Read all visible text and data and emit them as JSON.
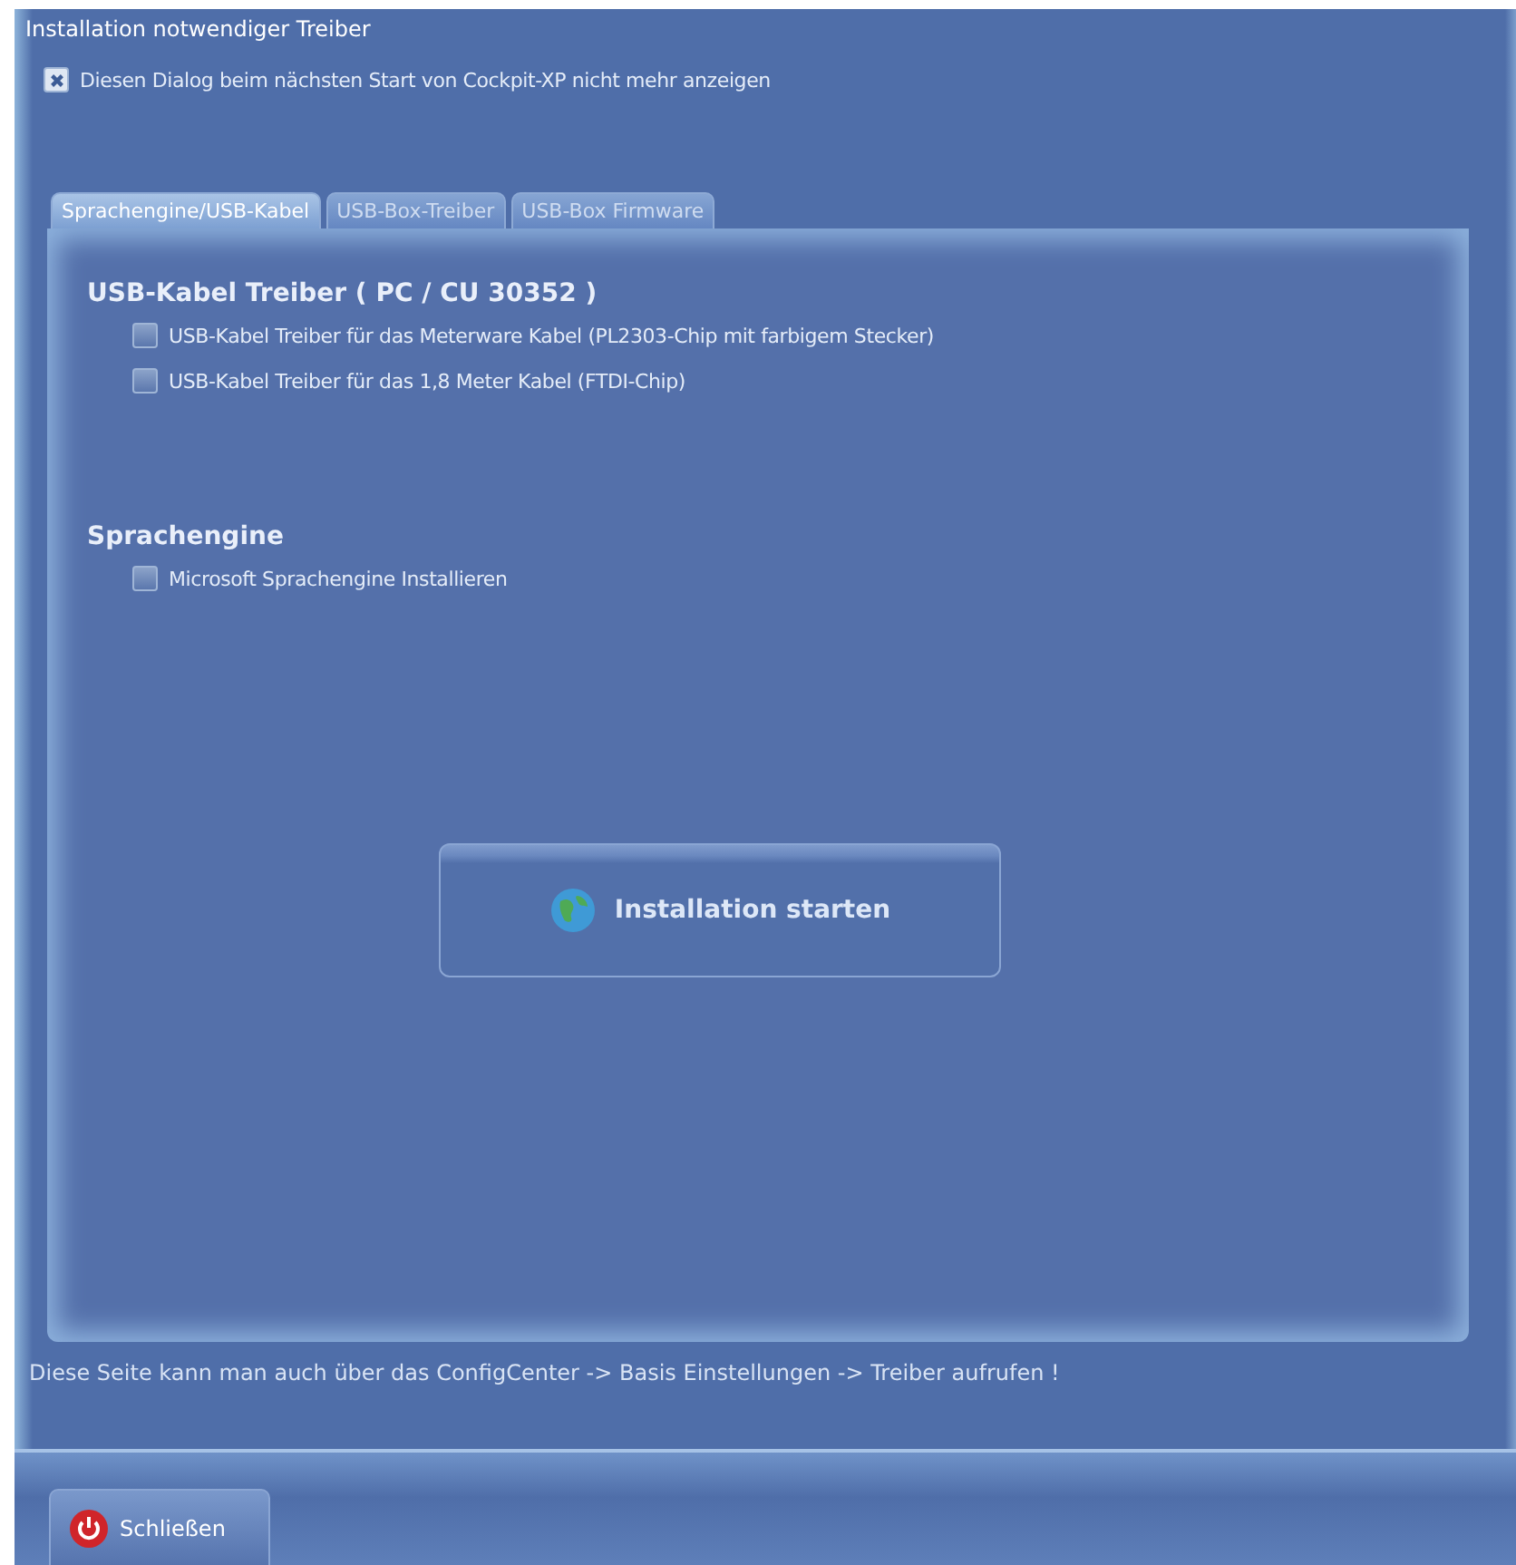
{
  "window": {
    "title": "Installation notwendiger Treiber"
  },
  "dont_show_again": {
    "label": "Diesen Dialog beim nächsten Start von Cockpit-XP nicht mehr anzeigen",
    "checked": true
  },
  "tabs": [
    {
      "label": "Sprachengine/USB-Kabel",
      "selected": true
    },
    {
      "label": "USB-Box-Treiber",
      "selected": false
    },
    {
      "label": "USB-Box Firmware",
      "selected": false
    }
  ],
  "sections": [
    {
      "heading": "USB-Kabel Treiber ( PC / CU 30352 )",
      "options": [
        {
          "label": "USB-Kabel Treiber für das Meterware Kabel (PL2303-Chip mit farbigem Stecker)",
          "checked": false
        },
        {
          "label": "USB-Kabel Treiber für das 1,8 Meter Kabel (FTDI-Chip)",
          "checked": false
        }
      ]
    },
    {
      "heading": "Sprachengine",
      "options": [
        {
          "label": "Microsoft Sprachengine Installieren",
          "checked": false
        }
      ]
    }
  ],
  "install_button": {
    "label": "Installation starten"
  },
  "hint": "Diese Seite kann man auch über das ConfigCenter -> Basis Einstellungen -> Treiber aufrufen !",
  "close_button": {
    "label": "Schließen"
  }
}
